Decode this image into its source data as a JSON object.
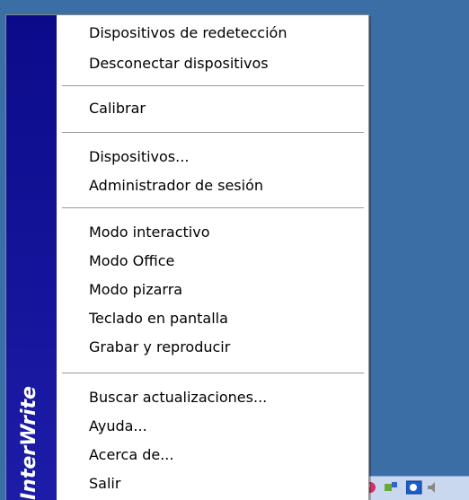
{
  "menu": {
    "brand": "InterWrite",
    "items": [
      {
        "label": "Dispositivos de redetección"
      },
      {
        "label": "Desconectar dispositivos"
      },
      {
        "label": "Calibrar"
      },
      {
        "label": "Dispositivos..."
      },
      {
        "label": "Administrador de sesión"
      },
      {
        "label": "Modo interactivo"
      },
      {
        "label": "Modo Office"
      },
      {
        "label": "Modo pizarra"
      },
      {
        "label": "Teclado en pantalla"
      },
      {
        "label": "Grabar y reproducir"
      },
      {
        "label": "Buscar actualizaciones..."
      },
      {
        "label": "Ayuda..."
      },
      {
        "label": "Acerca de..."
      },
      {
        "label": "Salir"
      }
    ]
  },
  "tray": {
    "icons": [
      "app-icon",
      "network-icon",
      "interwrite-tray-icon",
      "volume-icon"
    ]
  }
}
